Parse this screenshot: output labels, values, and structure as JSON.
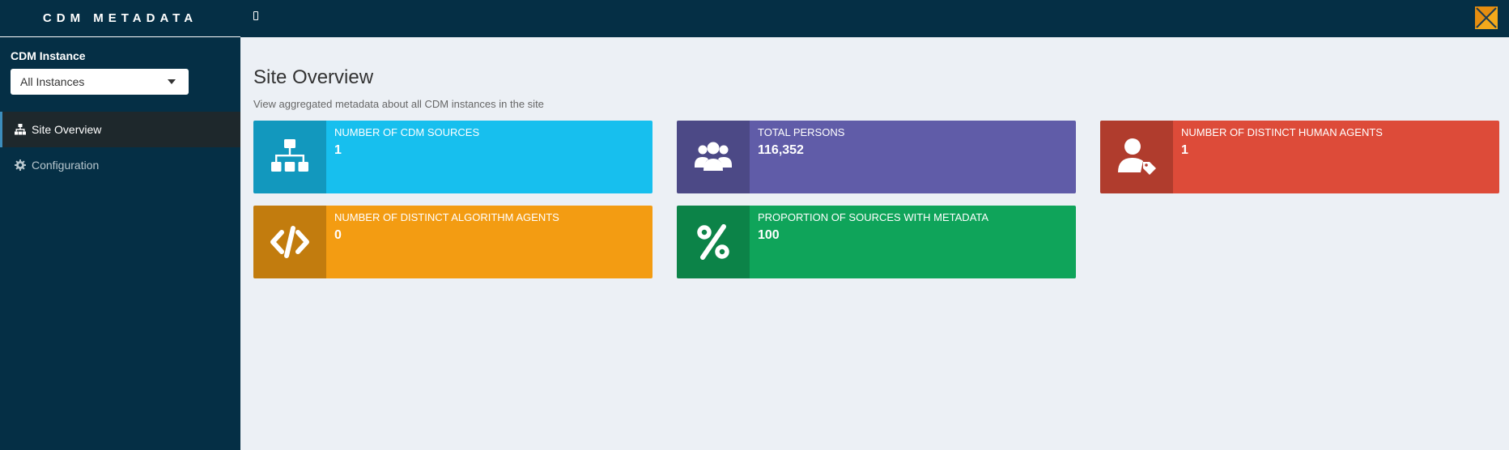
{
  "app": {
    "title": "CDM METADATA"
  },
  "sidebar": {
    "instance_label": "CDM Instance",
    "instance_select_value": "All Instances",
    "items": [
      {
        "label": "Site Overview",
        "icon": "sitemap-icon",
        "active": true
      },
      {
        "label": "Configuration",
        "icon": "gear-icon",
        "active": false
      }
    ]
  },
  "main": {
    "title": "Site Overview",
    "subtitle": "View aggregated metadata about all CDM instances in the site",
    "boxes": [
      {
        "label": "NUMBER OF CDM SOURCES",
        "value": "1",
        "color": "#17bfee",
        "icon": "sitemap-icon"
      },
      {
        "label": "TOTAL PERSONS",
        "value": "116,352",
        "color": "#605ca8",
        "icon": "users-icon"
      },
      {
        "label": "NUMBER OF DISTINCT HUMAN AGENTS",
        "value": "1",
        "color": "#dd4b39",
        "icon": "user-tag-icon"
      },
      {
        "label": "NUMBER OF DISTINCT ALGORITHM AGENTS",
        "value": "0",
        "color": "#f39c12",
        "icon": "code-icon"
      },
      {
        "label": "PROPORTION OF SOURCES WITH METADATA",
        "value": "100",
        "color": "#0fa45a",
        "icon": "percent-icon"
      }
    ]
  },
  "colors": {
    "header_bg": "#052f45",
    "content_bg": "#ecf0f5"
  }
}
